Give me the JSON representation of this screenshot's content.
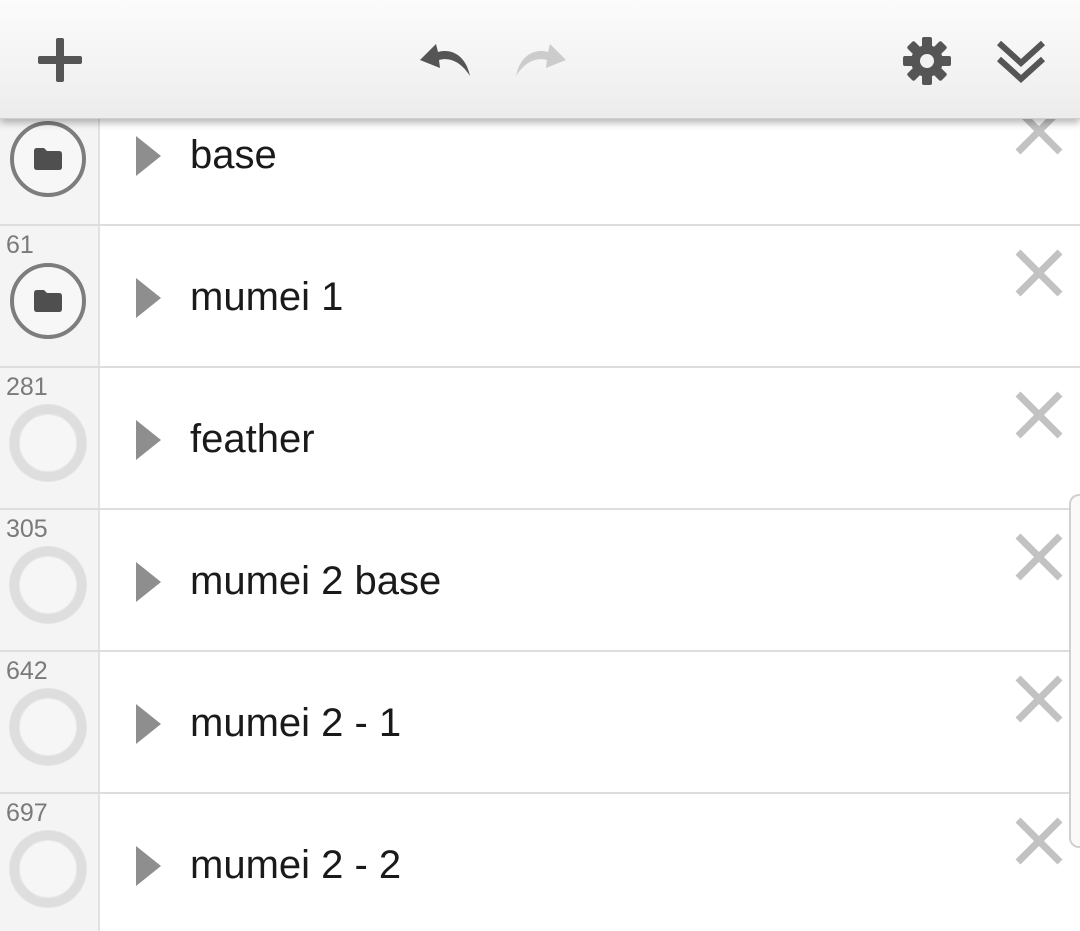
{
  "toolbar": {
    "add_icon": "plus-icon",
    "undo_icon": "undo-icon",
    "redo_icon": "redo-icon",
    "settings_icon": "gear-icon",
    "collapse_icon": "double-chevron-down-icon",
    "icon_color": "#555555",
    "disabled_icon_color": "#cccccc"
  },
  "layers": [
    {
      "count": "",
      "label": "base",
      "status": "folder"
    },
    {
      "count": "61",
      "label": "mumei 1",
      "status": "folder"
    },
    {
      "count": "281",
      "label": "feather",
      "status": "empty"
    },
    {
      "count": "305",
      "label": "mumei 2 base",
      "status": "empty"
    },
    {
      "count": "642",
      "label": "mumei 2 - 1",
      "status": "empty"
    },
    {
      "count": "697",
      "label": "mumei 2 - 2",
      "status": "empty"
    }
  ]
}
